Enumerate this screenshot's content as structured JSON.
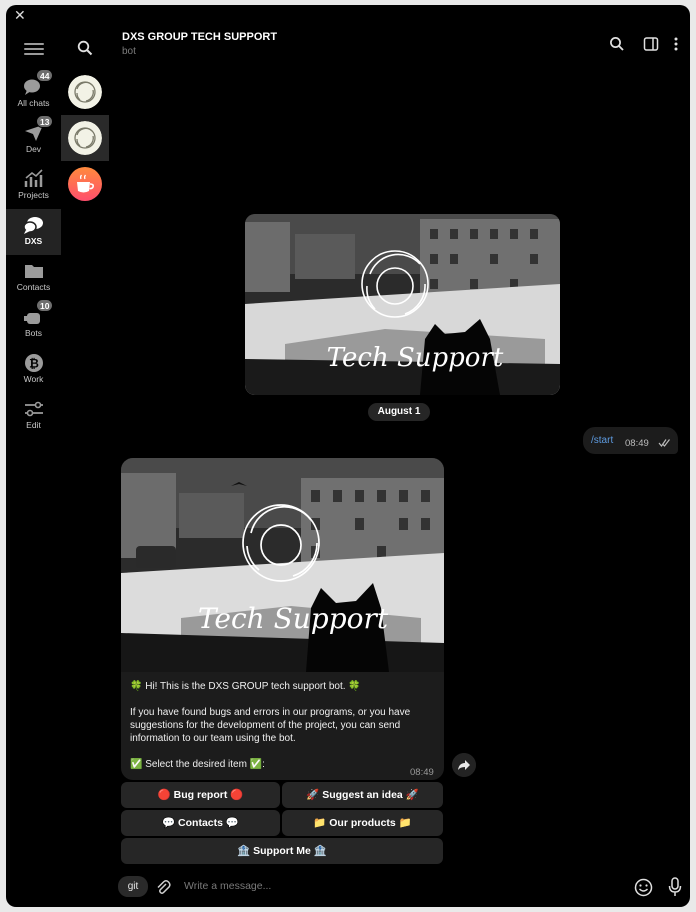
{
  "window": {
    "close_glyph": "✕"
  },
  "folders": [
    {
      "label": "All chats",
      "badge": "44",
      "icon": "chats-icon"
    },
    {
      "label": "Dev",
      "badge": "13",
      "icon": "paper-plane-icon"
    },
    {
      "label": "Projects",
      "badge": "",
      "icon": "chart-icon"
    },
    {
      "label": "DXS",
      "badge": "",
      "icon": "chat-bubbles-icon",
      "active": true
    },
    {
      "label": "Contacts",
      "badge": "",
      "icon": "folder-icon"
    },
    {
      "label": "Bots",
      "badge": "10",
      "icon": "bot-icon"
    },
    {
      "label": "Work",
      "badge": "",
      "icon": "bitcoin-icon"
    },
    {
      "label": "Edit",
      "badge": "",
      "icon": "sliders-icon"
    }
  ],
  "header": {
    "title": "DXS GROUP TECH SUPPORT",
    "subtitle": "bot"
  },
  "banner_caption": "Tech Support",
  "date_separator": "August 1",
  "outgoing": {
    "text": "/start",
    "time": "08:49"
  },
  "incoming": {
    "greeting": "🍀 Hi! This is the DXS GROUP tech support bot. 🍀",
    "body": "If you have found bugs and errors in our programs, or you have suggestions for the development of the project, you can send information to our team using the bot.",
    "prompt": "✅ Select the desired item ✅:",
    "time": "08:49"
  },
  "keyboard": {
    "bug_report": "🔴 Bug report 🔴",
    "suggest_idea": "🚀 Suggest an idea 🚀",
    "contacts": "💬 Contacts 💬",
    "our_products": "📁 Our products 📁",
    "support_me": "🏦 Support Me 🏦"
  },
  "input": {
    "chip": "git",
    "placeholder": "Write a message..."
  },
  "colors": {
    "accent": "#5e9be0",
    "bubble": "#1c1c1c",
    "button": "#262626",
    "background": "#000000"
  }
}
